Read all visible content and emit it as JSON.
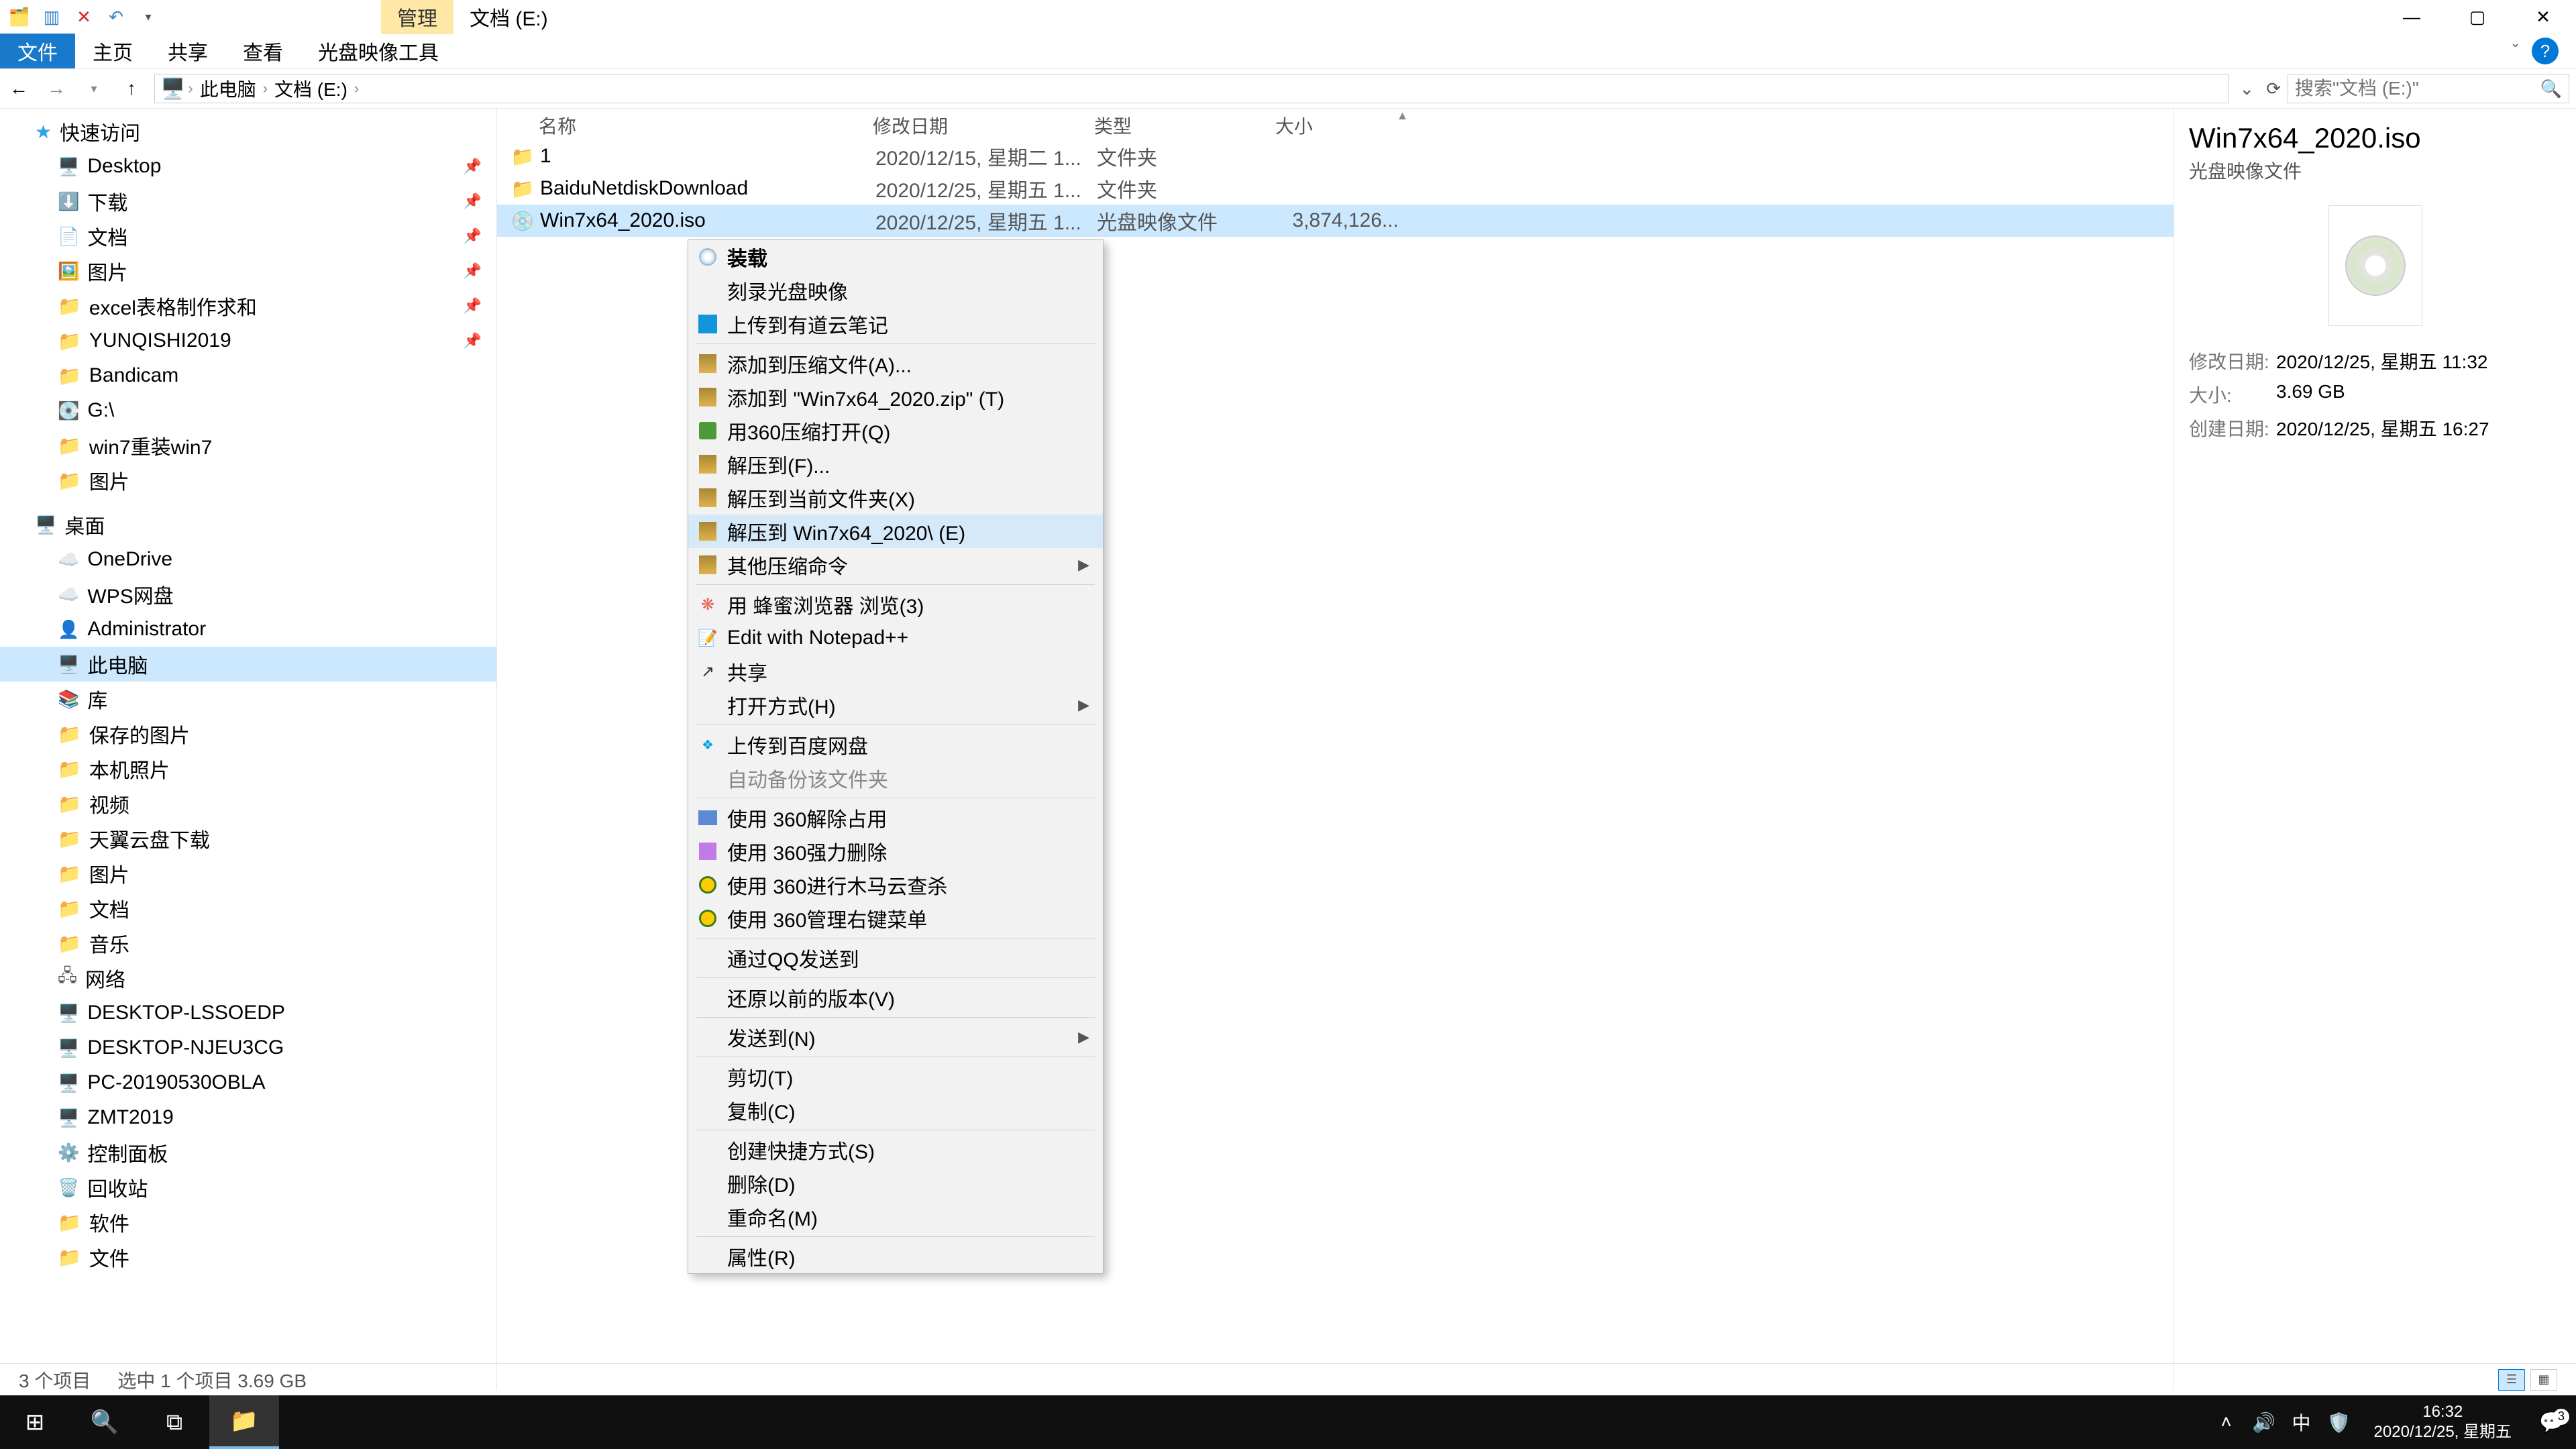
{
  "window": {
    "tab_label": "管理",
    "title": "文档 (E:)"
  },
  "ribbon": {
    "tabs": [
      "文件",
      "主页",
      "共享",
      "查看",
      "光盘映像工具"
    ]
  },
  "breadcrumb": {
    "root": "此电脑",
    "folder": "文档 (E:)"
  },
  "search": {
    "placeholder": "搜索\"文档 (E:)\""
  },
  "tree": {
    "quick_access": "快速访问",
    "pins": [
      "Desktop",
      "下载",
      "文档",
      "图片",
      "excel表格制作求和",
      "YUNQISHI2019"
    ],
    "more": [
      "Bandicam",
      "G:\\",
      "win7重装win7",
      "图片"
    ],
    "desktop": "桌面",
    "onedrive": "OneDrive",
    "wps": "WPS网盘",
    "admin": "Administrator",
    "thispc": "此电脑",
    "library": "库",
    "lib_items": [
      "保存的图片",
      "本机照片",
      "视频",
      "天翼云盘下载",
      "图片",
      "文档",
      "音乐"
    ],
    "network": "网络",
    "net_items": [
      "DESKTOP-LSSOEDP",
      "DESKTOP-NJEU3CG",
      "PC-20190530OBLA",
      "ZMT2019"
    ],
    "panel": "控制面板",
    "recycle": "回收站",
    "soft": "软件",
    "docs": "文件"
  },
  "columns": {
    "name": "名称",
    "date": "修改日期",
    "type": "类型",
    "size": "大小"
  },
  "files": [
    {
      "name": "1",
      "date": "2020/12/15, 星期二 1...",
      "type": "文件夹",
      "size": "",
      "icon": "folder"
    },
    {
      "name": "BaiduNetdiskDownload",
      "date": "2020/12/25, 星期五 1...",
      "type": "文件夹",
      "size": "",
      "icon": "folder"
    },
    {
      "name": "Win7x64_2020.iso",
      "date": "2020/12/25, 星期五 1...",
      "type": "光盘映像文件",
      "size": "3,874,126...",
      "icon": "iso"
    }
  ],
  "ctx": {
    "mount": "装载",
    "burn": "刻录光盘映像",
    "youdao": "上传到有道云笔记",
    "add_archive": "添加到压缩文件(A)...",
    "add_zip": "添加到 \"Win7x64_2020.zip\" (T)",
    "open_360zip": "用360压缩打开(Q)",
    "extract_to": "解压到(F)...",
    "extract_here": "解压到当前文件夹(X)",
    "extract_named": "解压到 Win7x64_2020\\ (E)",
    "other_zip": "其他压缩命令",
    "honey": "用 蜂蜜浏览器 浏览(3)",
    "npp": "Edit with Notepad++",
    "share": "共享",
    "open_with": "打开方式(H)",
    "baidu": "上传到百度网盘",
    "autobackup": "自动备份该文件夹",
    "u360_unlock": "使用 360解除占用",
    "u360_delete": "使用 360强力删除",
    "u360_scan": "使用 360进行木马云查杀",
    "u360_menu": "使用 360管理右键菜单",
    "qq_send": "通过QQ发送到",
    "restore": "还原以前的版本(V)",
    "send_to": "发送到(N)",
    "cut": "剪切(T)",
    "copy": "复制(C)",
    "shortcut": "创建快捷方式(S)",
    "delete": "删除(D)",
    "rename": "重命名(M)",
    "props": "属性(R)"
  },
  "preview": {
    "title": "Win7x64_2020.iso",
    "subtitle": "光盘映像文件",
    "mod_label": "修改日期:",
    "mod_val": "2020/12/25, 星期五 11:32",
    "size_label": "大小:",
    "size_val": "3.69 GB",
    "create_label": "创建日期:",
    "create_val": "2020/12/25, 星期五 16:27"
  },
  "status": {
    "count": "3 个项目",
    "selection": "选中 1 个项目  3.69 GB"
  },
  "taskbar": {
    "time": "16:32",
    "date": "2020/12/25, 星期五",
    "ime": "中",
    "notif_count": "3"
  }
}
